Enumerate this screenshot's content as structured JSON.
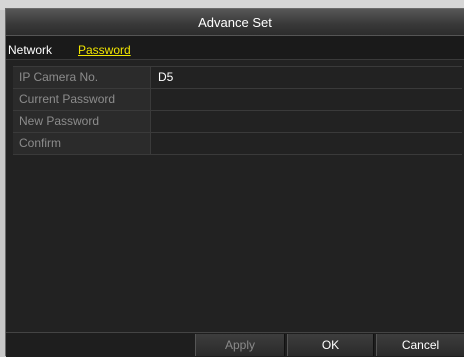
{
  "dialog": {
    "title": "Advance Set"
  },
  "tabs": [
    {
      "label": "Network",
      "active": false
    },
    {
      "label": "Password",
      "active": true
    }
  ],
  "form": {
    "rows": [
      {
        "label": "IP Camera No.",
        "value": "D5"
      },
      {
        "label": "Current Password",
        "value": ""
      },
      {
        "label": "New Password",
        "value": ""
      },
      {
        "label": "Confirm",
        "value": ""
      }
    ]
  },
  "buttons": {
    "apply": "Apply",
    "ok": "OK",
    "cancel": "Cancel"
  },
  "colors": {
    "active_tab": "#f2e600",
    "background": "#222222",
    "label_text": "#8c8c8c"
  }
}
